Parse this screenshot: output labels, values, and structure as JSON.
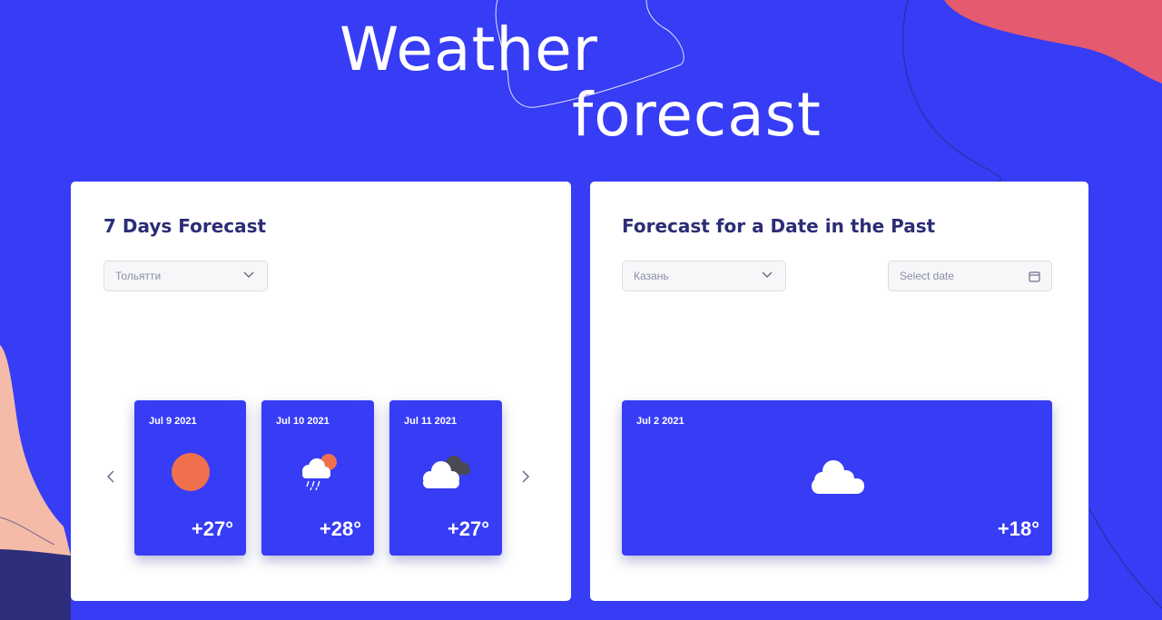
{
  "header": {
    "title_line1": "Weather",
    "title_line2": "forecast"
  },
  "forecast_panel": {
    "heading": "7 Days Forecast",
    "city_select": {
      "value": "Тольятти"
    },
    "cards": [
      {
        "date": "Jul 9 2021",
        "temp": "+27°",
        "icon": "sun-icon"
      },
      {
        "date": "Jul 10 2021",
        "temp": "+28°",
        "icon": "rain-cloud-sun-icon"
      },
      {
        "date": "Jul 11 2021",
        "temp": "+27°",
        "icon": "overcast-clouds-icon"
      }
    ],
    "prev_icon": "chevron-left-icon",
    "next_icon": "chevron-right-icon"
  },
  "past_panel": {
    "heading": "Forecast for a Date in the Past",
    "city_select": {
      "value": "Казань"
    },
    "date_input": {
      "placeholder": "Select date"
    },
    "card": {
      "date": "Jul 2 2021",
      "temp": "+18°",
      "icon": "cloud-icon"
    }
  },
  "colors": {
    "background": "#373cf5",
    "panel": "#ffffff",
    "heading": "#2c2d76",
    "card": "#373cf5",
    "sun": "#f0704d",
    "accent_coral": "#e45a6e",
    "accent_peach": "#f4bba8"
  }
}
